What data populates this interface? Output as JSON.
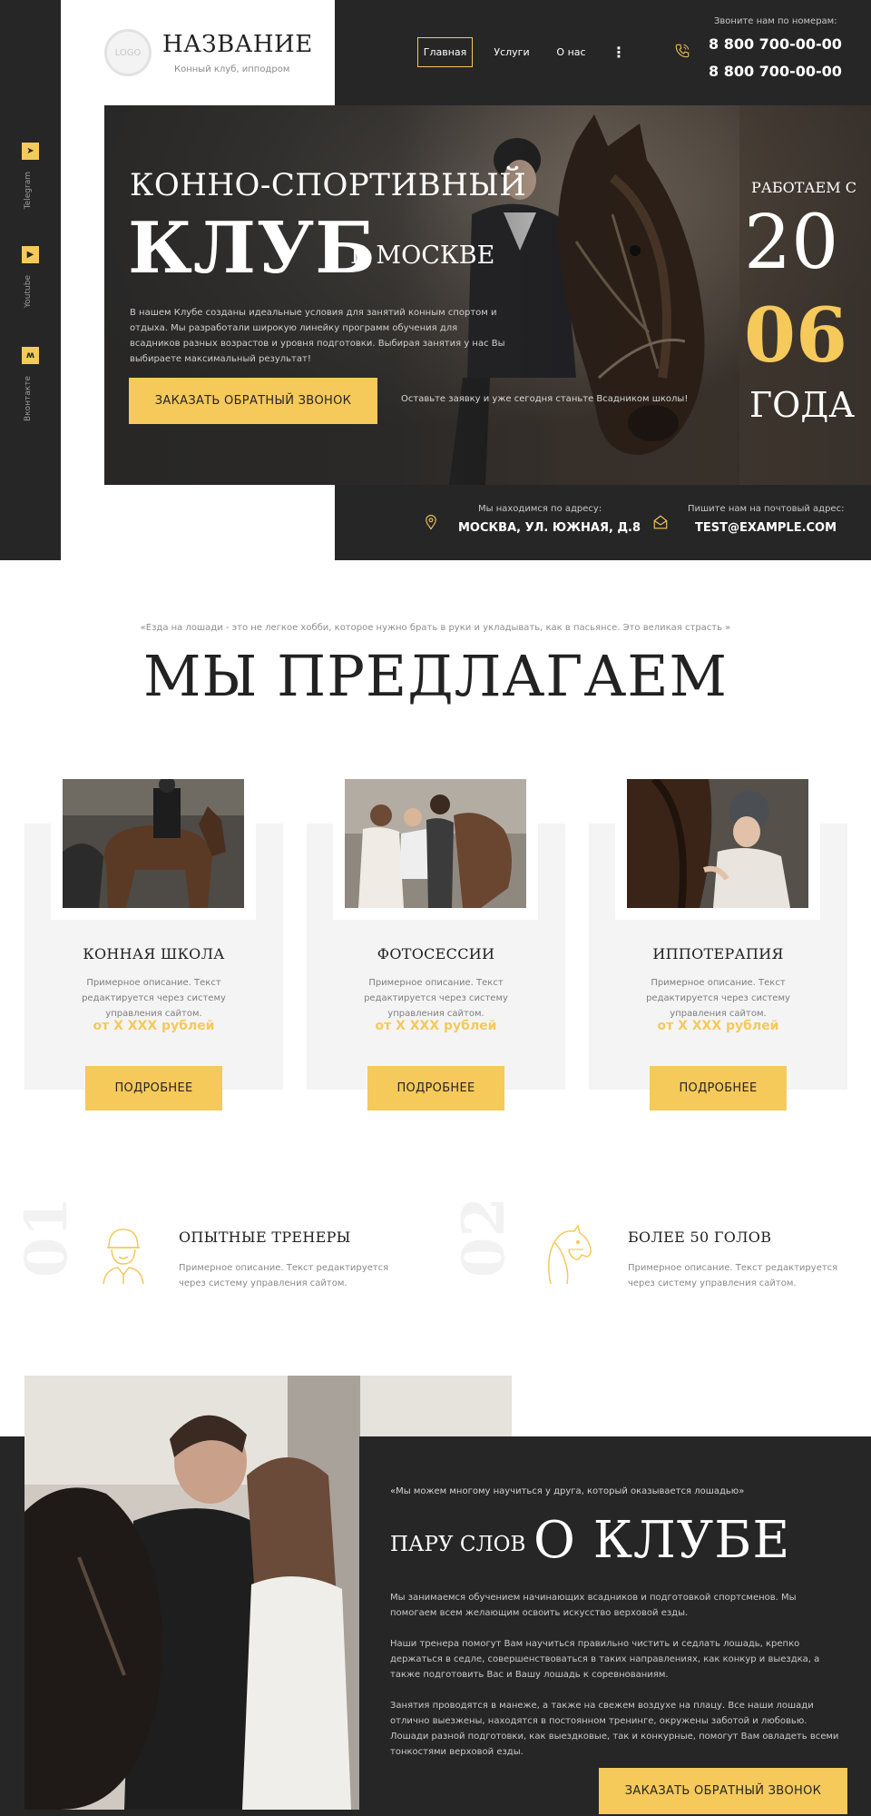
{
  "colors": {
    "accent": "#f5c95a",
    "dark": "#262626",
    "card_bg": "#f4f4f4"
  },
  "sidebar": {
    "socials": [
      {
        "label": "Telegram",
        "icon": "telegram-icon"
      },
      {
        "label": "Youtube",
        "icon": "youtube-icon"
      },
      {
        "label": "Вконтакте",
        "icon": "vk-icon"
      }
    ]
  },
  "header": {
    "logo_text": "LOGO",
    "site_name": "НАЗВАНИЕ",
    "site_sub": "Конный клуб, ипподром",
    "nav": {
      "home": "Главная",
      "services": "Услуги",
      "about": "О нас",
      "more": "⋮"
    },
    "call_label": "Звоните нам по номерам:",
    "phones": [
      "8 800 700-00-00",
      "8 800 700-00-00"
    ]
  },
  "hero": {
    "title_line1": "КОННО-СПОРТИВНЫЙ",
    "title_line2": "КЛУБ",
    "title_line3": "В МОСКВЕ",
    "description": "В нашем Клубе созданы идеальные условия для занятий конным спортом и отдыха. Мы разработали широкую линейку программ обучения для всадников разных возрастов и уровня подготовки. Выбирая занятия у нас Вы выбираете максимальный результат!",
    "cta": "ЗАКАЗАТЬ ОБРАТНЫЙ ЗВОНОК",
    "note": "Оставьте заявку и уже сегодня станьте Всадником школы!",
    "since_label": "РАБОТАЕМ С",
    "since_year1": "20",
    "since_year2": "06",
    "since_years": "ГОДА"
  },
  "contacts": {
    "address_label": "Мы находимся по адресу:",
    "address": "МОСКВА, УЛ. ЮЖНАЯ, Д.8",
    "email_label": "Пишите нам на почтовый адрес:",
    "email": "TEST@EXAMPLE.COM"
  },
  "offers": {
    "quote": "«Езда на лошади - это не легкое хобби, которое нужно брать в руки и укладывать, как в пасьянсе. Это великая страсть »",
    "title": "МЫ ПРЕДЛАГАЕМ",
    "cards": [
      {
        "title": "КОННАЯ ШКОЛА",
        "desc": "Примерное описание. Текст редактируется через систему управления сайтом.",
        "price": "от X XXX рублей",
        "button": "ПОДРОБНЕЕ"
      },
      {
        "title": "ФОТОСЕССИИ",
        "desc": "Примерное описание. Текст редактируется через систему управления сайтом.",
        "price": "от X XXX рублей",
        "button": "ПОДРОБНЕЕ"
      },
      {
        "title": "ИППОТЕРАПИЯ",
        "desc": "Примерное описание. Текст редактируется через систему управления сайтом.",
        "price": "от X XXX рублей",
        "button": "ПОДРОБНЕЕ"
      }
    ]
  },
  "features": [
    {
      "num": "01",
      "icon": "trainer-icon",
      "title": "ОПЫТНЫЕ ТРЕНЕРЫ",
      "desc": "Примерное описание. Текст редактируется через систему управления сайтом."
    },
    {
      "num": "02",
      "icon": "horse-head-icon",
      "title": "БОЛЕЕ 50 ГОЛОВ",
      "desc": "Примерное описание. Текст редактируется через систему управления сайтом."
    }
  ],
  "about": {
    "quote": "«Мы можем многому научиться у друга, который оказывается лошадью»",
    "pre_title": "ПАРУ СЛОВ",
    "title": "О КЛУБЕ",
    "paragraphs": [
      "Мы занимаемся обучением начинающих всадников и подготовкой спортсменов. Мы помогаем всем желающим освоить искусство верховой езды.",
      "Наши тренера помогут Вам научиться правильно чистить и седлать лошадь, крепко держаться в седле, совершенствоваться в таких направлениях, как конкур и выездка, а также подготовить Вас и Вашу лошадь к соревнованиям.",
      "Занятия проводятся в манеже, а также на свежем воздухе на плацу. Все наши лошади отлично выезжены, находятся в постоянном тренинге, окружены заботой и любовью. Лошади разной подготовки, как выездковые, так и конкурные, помогут Вам овладеть всеми тонкостями верховой езды."
    ],
    "cta": "ЗАКАЗАТЬ ОБРАТНЫЙ ЗВОНОК"
  }
}
